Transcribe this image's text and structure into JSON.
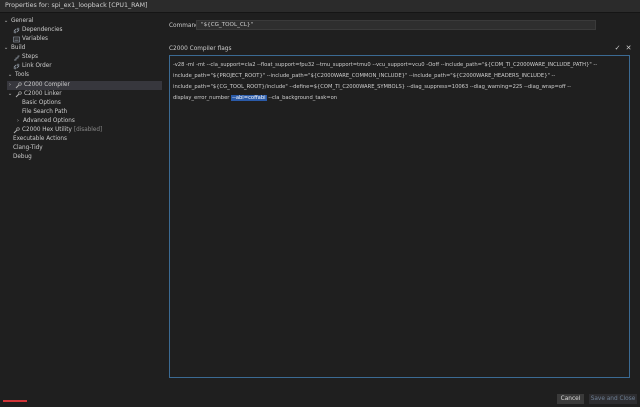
{
  "window": {
    "title": "Properties for: spi_ex1_loopback [CPU1_RAM]"
  },
  "sidebar": {
    "items": [
      {
        "label": "General",
        "chevron": "expanded"
      },
      {
        "label": "Dependencies",
        "icon": "link-icon"
      },
      {
        "label": "Variables",
        "icon": "variables-icon"
      },
      {
        "label": "Build",
        "chevron": "expanded"
      },
      {
        "label": "Steps",
        "icon": "steps-icon"
      },
      {
        "label": "Link Order",
        "icon": "link-icon"
      },
      {
        "label": "Tools",
        "chevron": "expanded"
      },
      {
        "label": "C2000 Compiler",
        "icon": "wrench-icon",
        "selected": true
      },
      {
        "label": "C2000 Linker",
        "chevron": "expanded",
        "icon": "wrench-icon"
      },
      {
        "label": "Basic Options"
      },
      {
        "label": "File Search Path"
      },
      {
        "label": "Advanced Options",
        "chevron": "collapsed"
      },
      {
        "label": "C2000 Hex Utility",
        "suffix": "[disabled]",
        "icon": "wrench-icon"
      },
      {
        "label": "Executable Actions"
      },
      {
        "label": "Clang-Tidy"
      },
      {
        "label": "Debug"
      }
    ]
  },
  "command": {
    "label": "Command",
    "value": "\"${CG_TOOL_CL}\""
  },
  "flags": {
    "label": "C2000 Compiler flags",
    "text_before": "-v28 -ml -mt --cla_support=cla2 --float_support=fpu32 --tmu_support=tmu0 --vcu_support=vcu0 -Ooff --include_path=\"${COM_TI_C2000WARE_INCLUDE_PATH}\" --include_path=\"${PROJECT_ROOT}\" --include_path=\"${C2000WARE_COMMON_INCLUDE}\" --include_path=\"${C2000WARE_HEADERS_INCLUDE}\" --include_path=\"${CG_TOOL_ROOT}/include\" --define=${COM_TI_C2000WARE_SYMBOLS} --diag_suppress=10063 --diag_warning=225 --diag_wrap=off --display_error_number",
    "highlighted": "--abi=coffabi",
    "text_after": "--cla_background_task=on"
  },
  "footer": {
    "cancel_label": "Cancel",
    "save_label": "Save and Close"
  }
}
